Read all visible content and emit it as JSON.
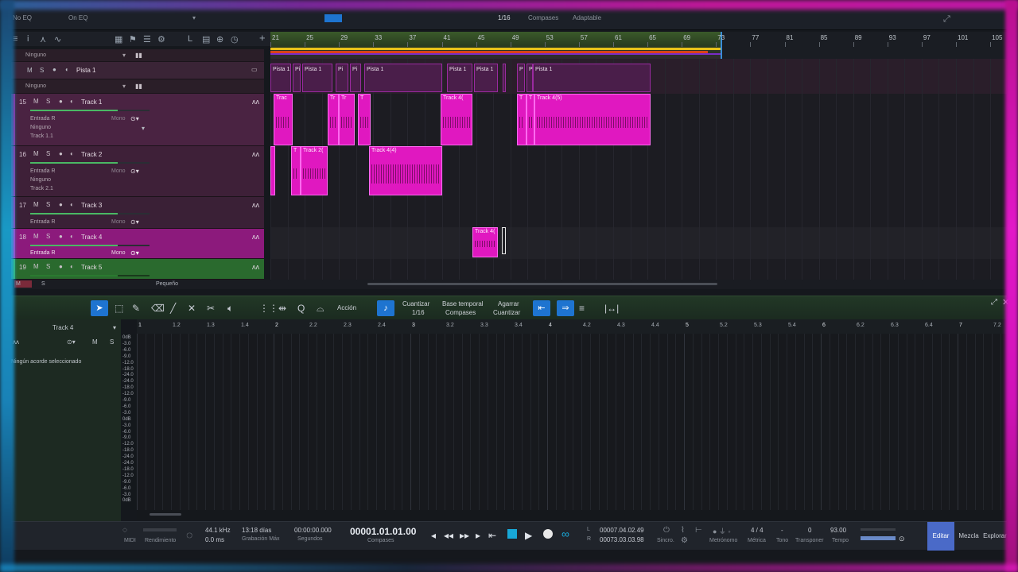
{
  "topbar": {
    "snap": "1/16",
    "timebase": "Compases",
    "mode": "Adaptable",
    "left_a": "No EQ",
    "left_b": "On EQ"
  },
  "ruler": {
    "marks": [
      "21",
      "25",
      "29",
      "33",
      "37",
      "41",
      "45",
      "49",
      "53",
      "57",
      "61",
      "65",
      "69",
      "73",
      "77",
      "81",
      "85",
      "89",
      "93",
      "97",
      "101",
      "105"
    ]
  },
  "tracks_header": {
    "folder_top_label": "Ninguno",
    "folder": {
      "m": "M",
      "s": "S",
      "name": "Pista 1"
    },
    "folder_bottom_label": "Ninguno",
    "items": [
      {
        "num": "15",
        "name": "Track 1",
        "input": "Entrada R",
        "mono": "Mono",
        "route": "Ninguno",
        "chan": "Track 1.1"
      },
      {
        "num": "16",
        "name": "Track 2",
        "input": "Entrada R",
        "mono": "Mono",
        "route": "Ninguno",
        "chan": "Track 2.1"
      },
      {
        "num": "17",
        "name": "Track 3",
        "input": "Entrada R",
        "mono": "Mono"
      },
      {
        "num": "18",
        "name": "Track 4",
        "input": "Entrada R",
        "mono": "Mono"
      },
      {
        "num": "19",
        "name": "Track 5"
      }
    ],
    "m": "M",
    "s": "S"
  },
  "clips": {
    "folder": [
      "Pista 1",
      "Pi",
      "Pista 1",
      "Pi",
      "Pi",
      "Pista 1",
      "Pista 1",
      "Pista 1",
      "P",
      "P",
      "Pista 1"
    ],
    "t1": [
      "Trac",
      "Tr",
      "Tr",
      "T",
      "Track 4(",
      "T",
      "T",
      "Track 4(5)"
    ],
    "t2": [
      "T",
      "Track 2(",
      "Track 4(4)"
    ],
    "t4": [
      "Track 4("
    ]
  },
  "arr_status": {
    "m": "M",
    "s": "S",
    "size": "Pequeño"
  },
  "editor_tools": {
    "action": "Acción",
    "quantize_label": "Cuantizar",
    "quantize_value": "1/16",
    "timebase_label": "Base temporal",
    "timebase_value": "Compases",
    "snap_label": "Agarrar",
    "snap_value": "Cuantizar"
  },
  "editor": {
    "track_name": "Track 4",
    "m": "M",
    "s": "S",
    "no_chord": "Ningún acorde seleccionado",
    "ruler": [
      "1",
      "1.2",
      "1.3",
      "1.4",
      "2",
      "2.2",
      "2.3",
      "2.4",
      "3",
      "3.2",
      "3.3",
      "3.4",
      "4",
      "4.2",
      "4.3",
      "4.4",
      "5",
      "5.2",
      "5.3",
      "5.4",
      "6",
      "6.2",
      "6.3",
      "6.4",
      "7",
      "7.2"
    ],
    "db": [
      "0dB",
      "-3.0",
      "-6.0",
      "-9.0",
      "-12.0",
      "-18.0",
      "-24.0",
      "-24.0",
      "-18.0",
      "-12.0",
      "-9.0",
      "-6.0",
      "-3.0",
      "0dB",
      "-3.0",
      "-6.0",
      "-9.0",
      "-12.0",
      "-18.0",
      "-24.0",
      "-24.0",
      "-18.0",
      "-12.0",
      "-9.0",
      "-6.0",
      "-3.0",
      "0dB"
    ]
  },
  "transport": {
    "midi": "MIDI",
    "perf": "Rendimiento",
    "rate": "44.1 kHz",
    "latency": "0.0 ms",
    "rec_time": "13:18 días",
    "rec_label": "Grabación Máx",
    "seconds": "00:00:00.000",
    "seconds_label": "Segundos",
    "position": "00001.01.01.00",
    "position_label": "Compases",
    "loop_l": "00007.04.02.49",
    "loop_r": "00073.03.03.98",
    "sync": "Sincro.",
    "metronome": "Metrónomo",
    "meter": "4 / 4",
    "meter_label": "Métrica",
    "key": "-",
    "key_label": "Tono",
    "transpose": "0",
    "transpose_label": "Transponer",
    "tempo": "93.00",
    "tempo_label": "Tempo",
    "tab_edit": "Editar",
    "tab_mix": "Mezcla",
    "tab_browse": "Explorar",
    "l": "L",
    "r": "R"
  }
}
